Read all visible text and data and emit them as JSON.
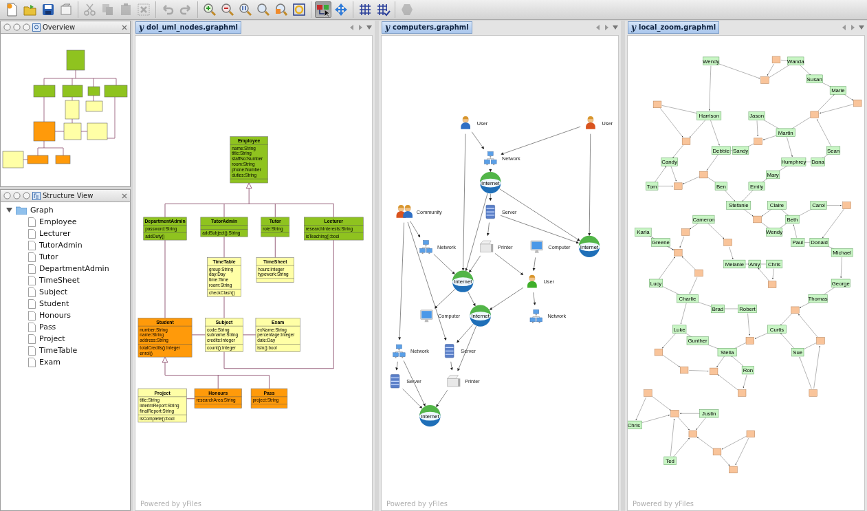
{
  "toolbar": [
    {
      "buttons": [
        {
          "kind": "new",
          "disabled": false,
          "selected": false
        },
        {
          "kind": "open",
          "disabled": false,
          "selected": false
        },
        {
          "kind": "save",
          "disabled": false,
          "selected": false
        },
        {
          "kind": "print",
          "disabled": false,
          "selected": false
        }
      ]
    },
    {
      "buttons": [
        {
          "kind": "cut",
          "disabled": true,
          "selected": false
        },
        {
          "kind": "copy",
          "disabled": true,
          "selected": false
        },
        {
          "kind": "paste",
          "disabled": true,
          "selected": false
        },
        {
          "kind": "delete",
          "disabled": true,
          "selected": false
        }
      ]
    },
    {
      "buttons": [
        {
          "kind": "undo",
          "disabled": true,
          "selected": false
        },
        {
          "kind": "redo",
          "disabled": true,
          "selected": false
        }
      ]
    },
    {
      "buttons": [
        {
          "kind": "zoom-in",
          "disabled": false,
          "selected": false
        },
        {
          "kind": "zoom-out",
          "disabled": false,
          "selected": false
        },
        {
          "kind": "zoom-reset",
          "disabled": false,
          "selected": false
        },
        {
          "kind": "zoom",
          "disabled": false,
          "selected": false
        },
        {
          "kind": "zoom-area",
          "disabled": false,
          "selected": false
        },
        {
          "kind": "fit",
          "disabled": false,
          "selected": false
        }
      ]
    },
    {
      "buttons": [
        {
          "kind": "select",
          "disabled": false,
          "selected": true
        },
        {
          "kind": "navigate",
          "disabled": false,
          "selected": false
        }
      ]
    },
    {
      "buttons": [
        {
          "kind": "grid",
          "disabled": false,
          "selected": false
        },
        {
          "kind": "snap",
          "disabled": false,
          "selected": false
        }
      ]
    },
    {
      "buttons": [
        {
          "kind": "hexagon",
          "disabled": true,
          "selected": false
        }
      ]
    }
  ],
  "overview": {
    "title": "Overview"
  },
  "structure": {
    "title": "Structure View",
    "root": {
      "label": "Graph",
      "expanded": true,
      "children": [
        {
          "label": "Employee"
        },
        {
          "label": "Lecturer"
        },
        {
          "label": "TutorAdmin"
        },
        {
          "label": "Tutor"
        },
        {
          "label": "DepartmentAdmin"
        },
        {
          "label": "TimeSheet"
        },
        {
          "label": "Subject"
        },
        {
          "label": "Student"
        },
        {
          "label": "Honours"
        },
        {
          "label": "Pass"
        },
        {
          "label": "Project"
        },
        {
          "label": "TimeTable"
        },
        {
          "label": "Exam"
        }
      ]
    }
  },
  "documents": [
    {
      "kind": "uml",
      "logo": "y",
      "title": "dol_uml_nodes.graphml",
      "footer": "Powered by yFiles",
      "classes": [
        {
          "name": "Employee",
          "color": "#8fc31f",
          "attributes": [
            "name:String",
            "title:String",
            "staffNo:Number",
            "room:String",
            "phone:Number",
            "duties:String"
          ]
        },
        {
          "name": "DepartmentAdmin",
          "color": "#8fc31f",
          "attributes": [
            "password:String"
          ],
          "methods": [
            "addDuty()"
          ]
        },
        {
          "name": "TutorAdmin",
          "color": "#8fc31f",
          "methods": [
            "addSubject():String"
          ]
        },
        {
          "name": "Tutor",
          "color": "#8fc31f",
          "attributes": [
            "role:String"
          ]
        },
        {
          "name": "Lecturer",
          "color": "#8fc31f",
          "attributes": [
            "researchInterests:String"
          ],
          "methods": [
            "isTeaching():bool"
          ]
        },
        {
          "name": "TimeTable",
          "color": "#ffffa6",
          "attributes": [
            "group:String",
            "day:Day",
            "time:Time",
            "room:String"
          ],
          "methods": [
            "checkClash()"
          ]
        },
        {
          "name": "TimeSheet",
          "color": "#ffffa6",
          "attributes": [
            "hours:Integer",
            "typework:String"
          ]
        },
        {
          "name": "Student",
          "color": "#ff9a0a",
          "attributes": [
            "number:String",
            "name:String",
            "address:String"
          ],
          "methods": [
            "totalCredits():Integer",
            "enrol()"
          ]
        },
        {
          "name": "Subject",
          "color": "#ffffa6",
          "attributes": [
            "code:String",
            "subname:String",
            "credits:Integer"
          ],
          "methods": [
            "count():Integer"
          ]
        },
        {
          "name": "Exam",
          "color": "#ffffa6",
          "attributes": [
            "exName:String",
            "percentage:Integer",
            "date:Day"
          ],
          "methods": [
            "isIn():bool"
          ]
        },
        {
          "name": "Project",
          "color": "#ffffa6",
          "attributes": [
            "title:String",
            "interimReport:String",
            "finalReport:String"
          ],
          "methods": [
            "isComplete():bool"
          ]
        },
        {
          "name": "Honours",
          "color": "#ff9a0a",
          "attributes": [
            "researchArea:String"
          ]
        },
        {
          "name": "Pass",
          "color": "#ff9a0a",
          "attributes": [
            "project:String"
          ]
        }
      ]
    },
    {
      "kind": "network",
      "logo": "y",
      "title": "computers.graphml",
      "footer": "Powered by yFiles",
      "nodes": [
        {
          "kind": "user",
          "label": "User",
          "color": "#2f6fc4"
        },
        {
          "kind": "user",
          "label": "User",
          "color": "#d9531e"
        },
        {
          "kind": "network",
          "label": "Network"
        },
        {
          "kind": "internet",
          "label": "Internet"
        },
        {
          "kind": "community",
          "label": "Community"
        },
        {
          "kind": "server",
          "label": "Server"
        },
        {
          "kind": "network",
          "label": "Network"
        },
        {
          "kind": "printer",
          "label": "Printer"
        },
        {
          "kind": "computer",
          "label": "Computer"
        },
        {
          "kind": "internet",
          "label": "Internet"
        },
        {
          "kind": "internet",
          "label": "Internet"
        },
        {
          "kind": "user",
          "label": "User",
          "color": "#3fae2a"
        },
        {
          "kind": "computer",
          "label": "Computer"
        },
        {
          "kind": "internet",
          "label": "Internet"
        },
        {
          "kind": "network",
          "label": "Network"
        },
        {
          "kind": "network",
          "label": "Network"
        },
        {
          "kind": "server",
          "label": "Server"
        },
        {
          "kind": "server",
          "label": "Server"
        },
        {
          "kind": "printer",
          "label": "Printer"
        },
        {
          "kind": "internet",
          "label": "Internet"
        }
      ]
    },
    {
      "kind": "social",
      "logo": "y",
      "title": "local_zoom.graphml",
      "footer": "Powered by yFiles",
      "nodes": [
        {
          "kind": "named",
          "label": "Wendy"
        },
        {
          "kind": "blank"
        },
        {
          "kind": "named",
          "label": "Wanda"
        },
        {
          "kind": "blank"
        },
        {
          "kind": "named",
          "label": "Susan"
        },
        {
          "kind": "named",
          "label": "Marie"
        },
        {
          "kind": "blank"
        },
        {
          "kind": "blank"
        },
        {
          "kind": "named",
          "label": "Harrison"
        },
        {
          "kind": "named",
          "label": "Jason"
        },
        {
          "kind": "blank"
        },
        {
          "kind": "named",
          "label": "Martin"
        },
        {
          "kind": "blank"
        },
        {
          "kind": "blank"
        },
        {
          "kind": "named",
          "label": "Debbie"
        },
        {
          "kind": "named",
          "label": "Sandy"
        },
        {
          "kind": "named",
          "label": "Sean"
        },
        {
          "kind": "named",
          "label": "Candy"
        },
        {
          "kind": "named",
          "label": "Humphrey"
        },
        {
          "kind": "named",
          "label": "Dana"
        },
        {
          "kind": "blank"
        },
        {
          "kind": "named",
          "label": "Mary"
        },
        {
          "kind": "named",
          "label": "Tom"
        },
        {
          "kind": "blank"
        },
        {
          "kind": "named",
          "label": "Ben"
        },
        {
          "kind": "named",
          "label": "Emily"
        },
        {
          "kind": "named",
          "label": "Stefanie"
        },
        {
          "kind": "named",
          "label": "Claire"
        },
        {
          "kind": "named",
          "label": "Carol"
        },
        {
          "kind": "blank"
        },
        {
          "kind": "named",
          "label": "Cameron"
        },
        {
          "kind": "blank"
        },
        {
          "kind": "named",
          "label": "Beth"
        },
        {
          "kind": "named",
          "label": "Karla"
        },
        {
          "kind": "blank"
        },
        {
          "kind": "named",
          "label": "Wendy"
        },
        {
          "kind": "named",
          "label": "Greene"
        },
        {
          "kind": "blank"
        },
        {
          "kind": "named",
          "label": "Paul"
        },
        {
          "kind": "named",
          "label": "Donald"
        },
        {
          "kind": "blank"
        },
        {
          "kind": "named",
          "label": "Michael"
        },
        {
          "kind": "named",
          "label": "Melanie"
        },
        {
          "kind": "named",
          "label": "Amy"
        },
        {
          "kind": "named",
          "label": "Chris"
        },
        {
          "kind": "blank"
        },
        {
          "kind": "named",
          "label": "Lucy"
        },
        {
          "kind": "blank"
        },
        {
          "kind": "named",
          "label": "George"
        },
        {
          "kind": "named",
          "label": "Charlie"
        },
        {
          "kind": "named",
          "label": "Thomas"
        },
        {
          "kind": "named",
          "label": "Brad"
        },
        {
          "kind": "named",
          "label": "Robert"
        },
        {
          "kind": "blank"
        },
        {
          "kind": "named",
          "label": "Luke"
        },
        {
          "kind": "named",
          "label": "Curtis"
        },
        {
          "kind": "named",
          "label": "Gunther"
        },
        {
          "kind": "blank"
        },
        {
          "kind": "blank"
        },
        {
          "kind": "blank"
        },
        {
          "kind": "named",
          "label": "Stella"
        },
        {
          "kind": "named",
          "label": "Sue"
        },
        {
          "kind": "blank"
        },
        {
          "kind": "blank"
        },
        {
          "kind": "named",
          "label": "Ron"
        },
        {
          "kind": "blank"
        },
        {
          "kind": "blank"
        },
        {
          "kind": "blank"
        },
        {
          "kind": "blank"
        },
        {
          "kind": "named",
          "label": "Justin"
        },
        {
          "kind": "named",
          "label": "Chris"
        },
        {
          "kind": "blank"
        },
        {
          "kind": "blank"
        },
        {
          "kind": "blank"
        },
        {
          "kind": "named",
          "label": "Ted"
        },
        {
          "kind": "blank"
        }
      ]
    }
  ]
}
